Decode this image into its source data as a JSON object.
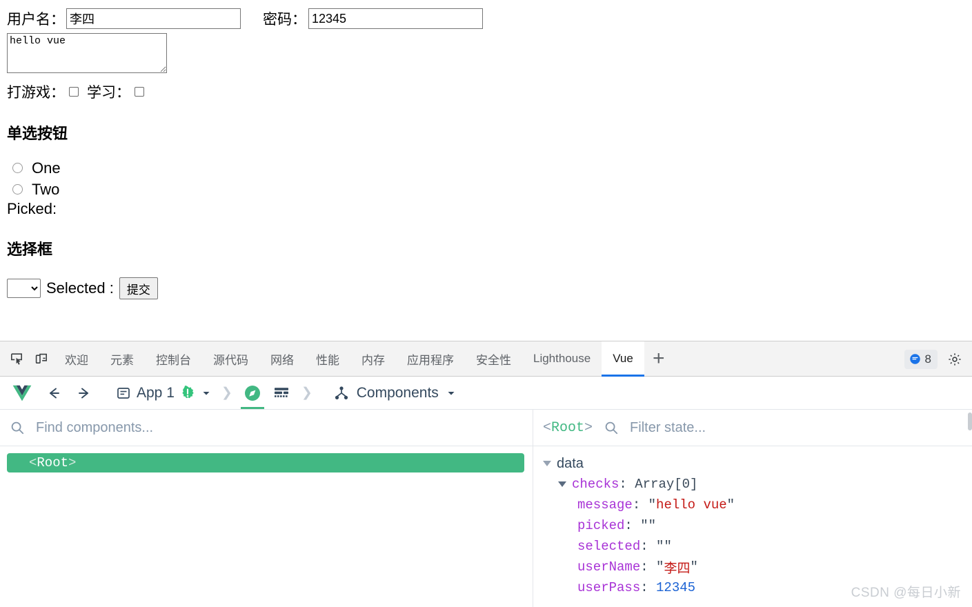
{
  "page": {
    "username_label": "用户名：",
    "username_value": "李四",
    "password_label": "密码：",
    "password_value": "12345",
    "textarea_value": "hello vue",
    "game_label": "打游戏：",
    "study_label": "学习：",
    "radio_heading": "单选按钮",
    "radio_one": "One",
    "radio_two": "Two",
    "picked_label": "Picked:",
    "select_heading": "选择框",
    "selected_label": "Selected :",
    "submit_label": "提交",
    "select_value": ""
  },
  "devtools": {
    "tabs": [
      {
        "label": "欢迎",
        "active": false
      },
      {
        "label": "元素",
        "active": false
      },
      {
        "label": "控制台",
        "active": false
      },
      {
        "label": "源代码",
        "active": false
      },
      {
        "label": "网络",
        "active": false
      },
      {
        "label": "性能",
        "active": false
      },
      {
        "label": "内存",
        "active": false
      },
      {
        "label": "应用程序",
        "active": false
      },
      {
        "label": "安全性",
        "active": false
      },
      {
        "label": "Lighthouse",
        "active": false
      },
      {
        "label": "Vue",
        "active": true
      }
    ],
    "add_tab_label": "+",
    "info_count": "8",
    "accent_color": "#1a73e8"
  },
  "vue": {
    "app_name": "App 1",
    "components_label": "Components",
    "accent_color": "#42b883",
    "components_panel": {
      "search_placeholder": "Find components...",
      "tree": [
        {
          "open_bracket": "<",
          "name": "Root",
          "close_bracket": ">",
          "selected": true
        }
      ]
    },
    "state_panel": {
      "root_open": "<",
      "root_name": "Root",
      "root_close": ">",
      "filter_placeholder": "Filter state...",
      "group_label": "data",
      "entries": [
        {
          "key": "checks",
          "value": "Array[0]",
          "kind": "type",
          "expandable": true
        },
        {
          "key": "message",
          "value": "hello vue",
          "kind": "string",
          "expandable": false
        },
        {
          "key": "picked",
          "value": "",
          "kind": "string",
          "expandable": false
        },
        {
          "key": "selected",
          "value": "",
          "kind": "string",
          "expandable": false
        },
        {
          "key": "userName",
          "value": "李四",
          "kind": "string",
          "expandable": false
        },
        {
          "key": "userPass",
          "value": "12345",
          "kind": "number",
          "expandable": false
        }
      ]
    }
  },
  "watermark": "CSDN @每日小新"
}
